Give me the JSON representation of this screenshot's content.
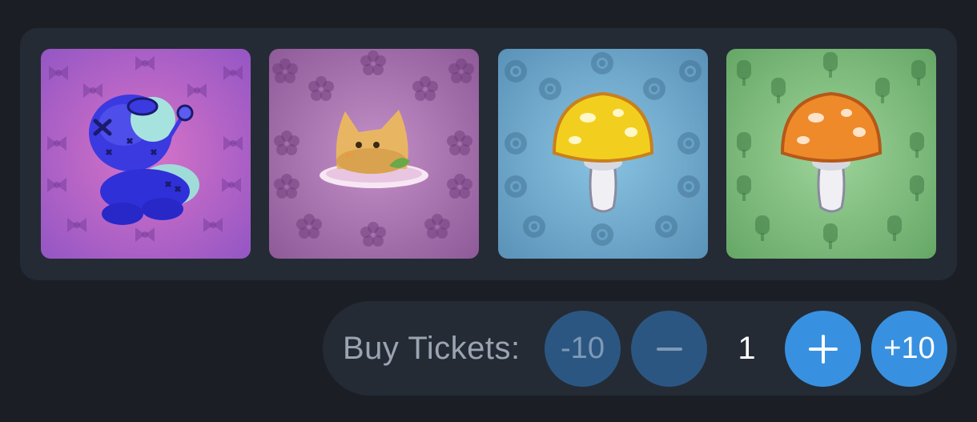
{
  "items": [
    {
      "name": "voodoo-doll",
      "background_color": "#a45fc7",
      "pattern_icon": "bow-icon"
    },
    {
      "name": "cat-bread-dish",
      "background_color": "#9f6fa8",
      "pattern_icon": "flower-icon"
    },
    {
      "name": "yellow-mushroom",
      "background_color": "#6ba8cc",
      "pattern_icon": "sunflower-icon"
    },
    {
      "name": "orange-mushroom",
      "background_color": "#7ab37a",
      "pattern_icon": "popsicle-icon"
    }
  ],
  "tickets": {
    "label": "Buy Tickets:",
    "minus_ten": "-10",
    "minus_one_icon": "minus-icon",
    "quantity": "1",
    "plus_one_icon": "plus-icon",
    "plus_ten": "+10"
  },
  "colors": {
    "page_bg": "#1b1f25",
    "panel_bg": "#242b35",
    "button_dim": "#2c5682",
    "button_active": "#3891e0"
  }
}
